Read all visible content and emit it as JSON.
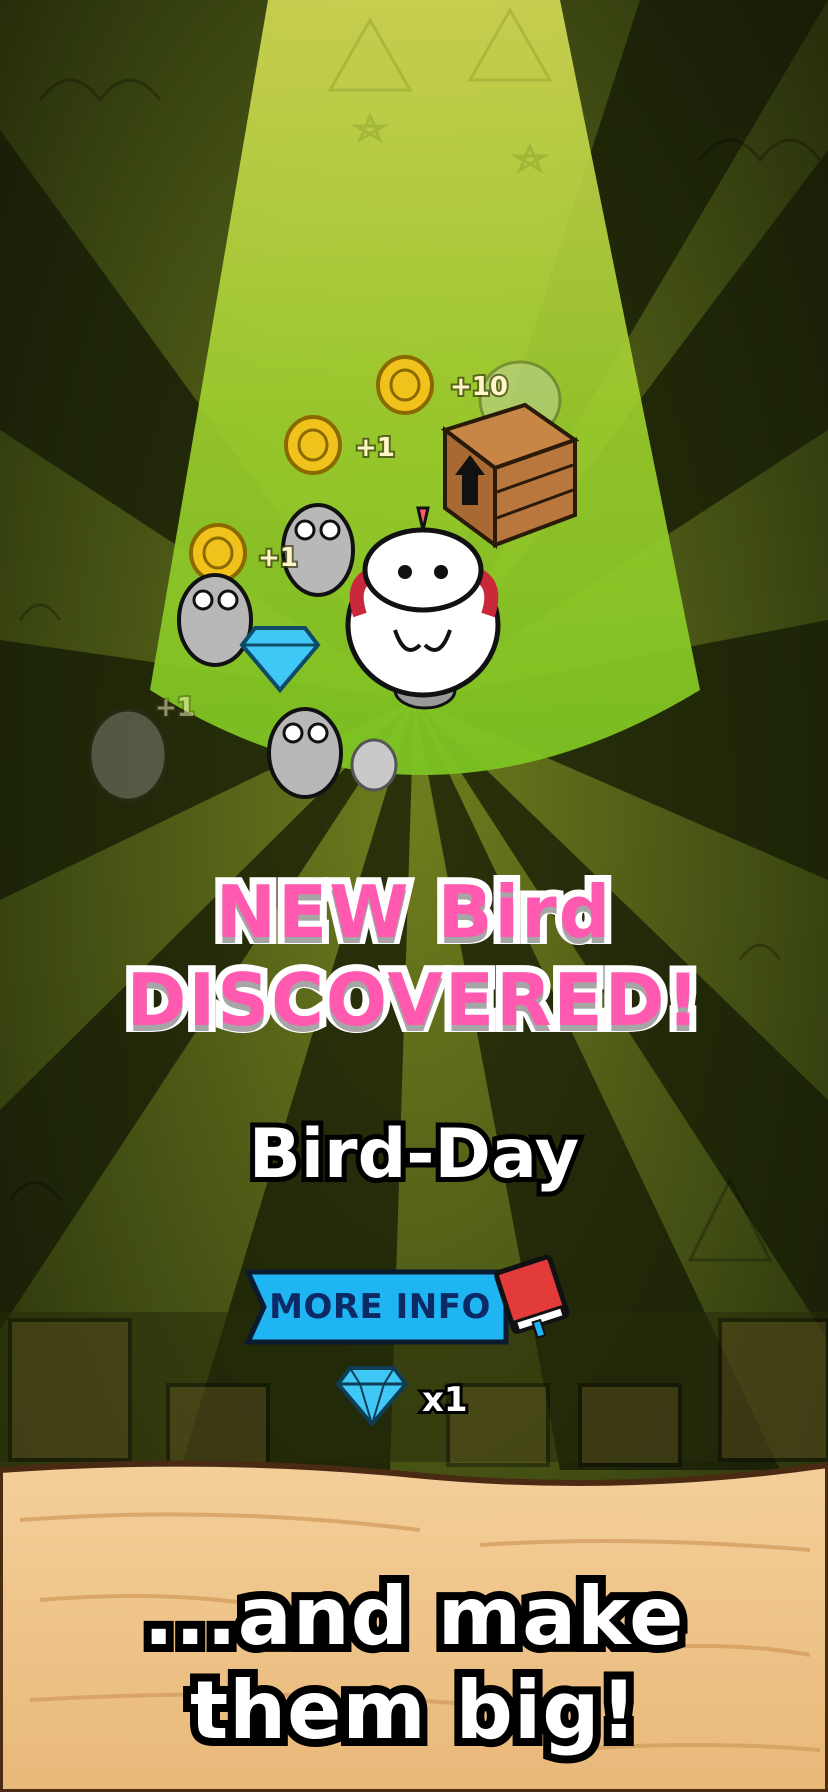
{
  "headline": {
    "line1": "NEW Bird",
    "line2": "DISCOVERED!"
  },
  "bird": {
    "name": "Bird-Day"
  },
  "more_info": {
    "label": "MORE INFO"
  },
  "reward": {
    "icon": "diamond-icon",
    "count": "x1"
  },
  "coin_popups": [
    "+10",
    "+1",
    "+1",
    "+1"
  ],
  "slogan": {
    "line1": "...and make",
    "line2": "them big!"
  },
  "colors": {
    "headline_fill": "#ff5ab0",
    "button_blue": "#1fb4f2",
    "book_red": "#e33a3a",
    "gem_blue": "#3fc8f5",
    "coin_gold": "#f1c21b",
    "wood": "#f0c690"
  }
}
